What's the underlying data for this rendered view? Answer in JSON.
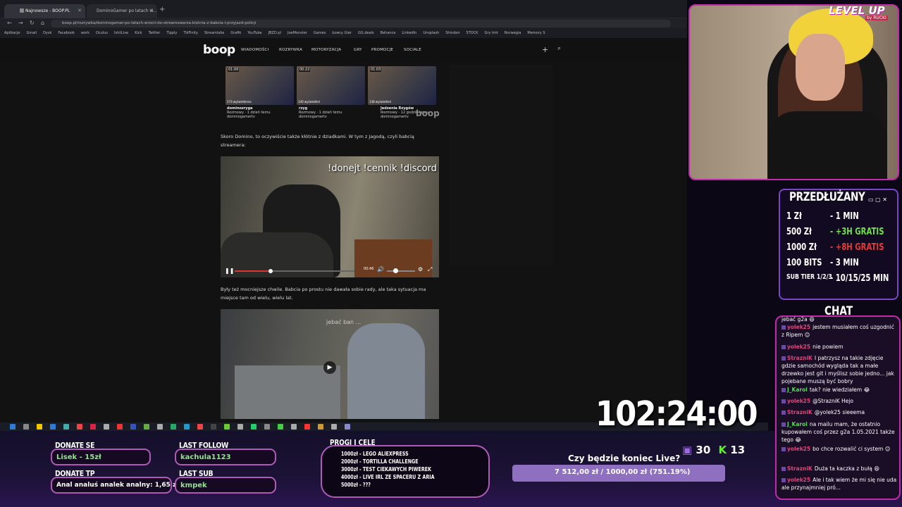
{
  "browser": {
    "tabs": [
      {
        "label": "Najnowsze - BOOP.PL"
      },
      {
        "label": "DominoGamer po latach w..."
      }
    ],
    "url": "boop.pl/rozrywka/dominogamer-po-latach-wrocil-do-streamowania-klotnia-z-babcia-i-przyjazd-policji",
    "bookmarks": [
      "Aplikacje",
      "Gmail",
      "Dysk",
      "Facebook",
      "work",
      "Oculus",
      "IshiiLive",
      "Kick",
      "Twitter",
      "Tipply",
      "TikFinity",
      "Streamlabs",
      "Grafik",
      "YouTube",
      "JBZD.pl",
      "JoeMonster",
      "Games",
      "Łowcy Gier",
      "GG.deals",
      "Behance",
      "LinkedIn",
      "Unsplash",
      "Shinden",
      "STOCK",
      "Gry tmt",
      "Norwegia",
      "Memory S"
    ]
  },
  "site": {
    "logo": "boop",
    "menu": [
      "WIADOMOŚCI",
      "ROZRYWKA",
      "MOTORYZACJA",
      "GRY",
      "PROMOCJE",
      "SOCIALE"
    ],
    "thumbs": [
      {
        "dur": "01:00",
        "views": "173 wyświetlenia",
        "title": "dominozryga",
        "meta": "Rozmowy · 1 dzień temu",
        "channel": "dominogamertv"
      },
      {
        "dur": "00:22",
        "views": "140 wyświetleń",
        "title": "rzyg",
        "meta": "Rozmowy · 1 dzień temu",
        "channel": "dominogamertv"
      },
      {
        "dur": "01:03",
        "views": "138 wyświetleń",
        "title": "Jedzenia Rzygów",
        "meta": "Rozmowy · 12 godzin temu",
        "channel": "dominogamertv"
      }
    ],
    "watermark": "boop",
    "para1": "Skoro Domino, to oczywiście także kłótnie z dziadkami. W tym z Jagodą, czyli babcią streamera:",
    "video1_overlay": "!donejt !cennik !discord",
    "video1_time": "00:46",
    "video1_progress": 0.3,
    "video1_volume": 0.3,
    "para2": "Były też mocniejsze chwile. Babcia po prostu nie dawała sobie rady, ale taka sytuacja ma miejsce tam od wielu, wielu lat.",
    "video2_overlay": "jebać ban ...",
    "video2_play": "▶"
  },
  "overlay": {
    "donate_se_title": "DONATE SE",
    "donate_se_val": "Lisek - 15zł",
    "donate_tp_title": "DONATE TP",
    "donate_tp_val": "Anal analuś analek analny: 1,65 zł",
    "last_follow_title": "LAST FOLLOW",
    "last_follow_val": "kachula1123",
    "last_sub_title": "LAST SUB",
    "last_sub_val": "kmpek",
    "goals_title": "PROGI I CELE",
    "goals": [
      "1000zł - LEGO ALIEXPRESS",
      "2000zł - TORTILLA CHALLENGE",
      "3000zł - TEST CIEKAWYCH PIWEREK",
      "4000zł - LIVE IRL ZE SPACERU Z ARIA",
      "5000zł - ???"
    ],
    "poll_question": "Czy będzie koniec Live?",
    "poll_bar": "7 512,00 zł / 1000,00 zł (751.19%)",
    "poll_fraction": 1.0,
    "viewers_a": "30",
    "viewers_b": "13",
    "timer": "102:24:00",
    "level_up": "LEVEL UP",
    "level_sub": "by RUCKI"
  },
  "subathon": {
    "title": "PRZEDŁUŻANY",
    "rows": [
      {
        "k": "1 Zł",
        "v": "- 1 MIN",
        "color": "#ffffff"
      },
      {
        "k": "500 Zł",
        "v": "- +3H GRATIS",
        "color": "#6fe04a"
      },
      {
        "k": "1000 Zł",
        "v": "- +8H GRATIS",
        "color": "#e23a3a"
      },
      {
        "k": "100 BITS",
        "v": "- 3 MIN",
        "color": "#ffffff"
      },
      {
        "k": "SUB TIER 1/2/3",
        "v": "- 10/15/25 MIN",
        "color": "#ffffff"
      }
    ]
  },
  "chat": {
    "title": "CHAT",
    "messages": [
      {
        "user": "",
        "text": "jebać g2a 😄",
        "color": "#fff"
      },
      {
        "user": "yolek25",
        "text": "jestem musiałem coś uzgodnić z Ripem 😊",
        "color": "#e0457b"
      },
      {
        "user": "yolek25",
        "text": "nie powiem",
        "color": "#e0457b"
      },
      {
        "user": "StrazniK",
        "text": "I patrzysz na takie zdjęcie gdzie samochód wygląda tak a małe drzewko jest git i myślisz sobie jedno... jak pojebane muszą być bobry",
        "color": "#e0457b"
      },
      {
        "user": "J_Karol",
        "text": "tak? nie wiedziałem 😂",
        "color": "#5ad85a"
      },
      {
        "user": "yolek25",
        "text": "@StrazniK Hejo",
        "color": "#e0457b"
      },
      {
        "user": "StrazniK",
        "text": "@yolek25 sieeema",
        "color": "#e0457b"
      },
      {
        "user": "J_Karol",
        "text": "na mailu mam, że ostatnio kupowałem coś przez g2a 1.05.2021 także tego 😂",
        "color": "#5ad85a"
      },
      {
        "user": "yolek25",
        "text": "bo chce rozwalić ci system 😊",
        "color": "#e0457b"
      },
      {
        "user": "StrazniK",
        "text": "Duża ta kaczka z bułą 😄",
        "color": "#e0457b"
      },
      {
        "user": "yolek25",
        "text": "Ale i tak wiem że mi się nie uda ale przynajmniej pró...",
        "color": "#e0457b"
      }
    ]
  }
}
